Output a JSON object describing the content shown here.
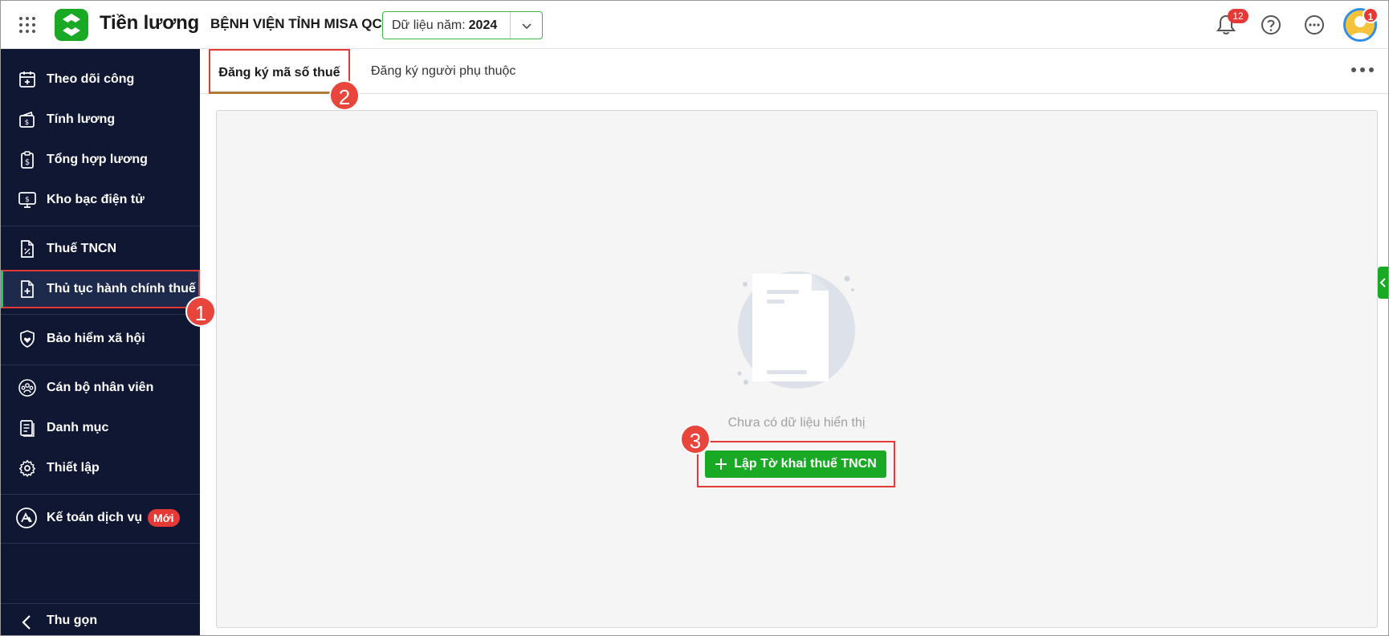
{
  "header": {
    "app_title": "Tiền lương",
    "org_name": "BỆNH VIỆN TỈNH MISA QC",
    "year_label": "Dữ liệu năm:",
    "year_value": "2024",
    "notification_count": "12",
    "avatar_badge": "1"
  },
  "sidebar": {
    "items": [
      {
        "label": "Theo dõi công",
        "icon": "calendar-plus-icon"
      },
      {
        "label": "Tính lương",
        "icon": "wallet-money-icon"
      },
      {
        "label": "Tổng hợp lương",
        "icon": "clipboard-dollar-icon"
      },
      {
        "label": "Kho bạc điện tử",
        "icon": "monitor-dollar-icon"
      },
      {
        "label": "Thuế TNCN",
        "icon": "document-percent-icon"
      },
      {
        "label": "Thủ tục hành chính thuế",
        "icon": "document-plus-icon"
      },
      {
        "label": "Bảo hiểm xã hội",
        "icon": "shield-heart-icon"
      },
      {
        "label": "Cán bộ nhân viên",
        "icon": "people-group-icon"
      },
      {
        "label": "Danh mục",
        "icon": "list-document-icon"
      },
      {
        "label": "Thiết lập",
        "icon": "gear-icon"
      },
      {
        "label": "Kế toán dịch vụ",
        "icon": "accounting-service-icon",
        "badge": "Mới"
      }
    ],
    "collapse_label": "Thu gọn"
  },
  "markers": [
    "1",
    "2",
    "3"
  ],
  "tabs": [
    {
      "label": "Đăng ký mã số thuế",
      "active": true
    },
    {
      "label": "Đăng ký người phụ thuộc",
      "active": false
    }
  ],
  "main": {
    "empty_text": "Chưa có dữ liệu hiển thị",
    "create_button": "Lập Tờ khai thuế TNCN"
  },
  "colors": {
    "sidebar_bg": "#0f1733",
    "brand_green": "#19a924",
    "highlight_red": "#e53935"
  }
}
